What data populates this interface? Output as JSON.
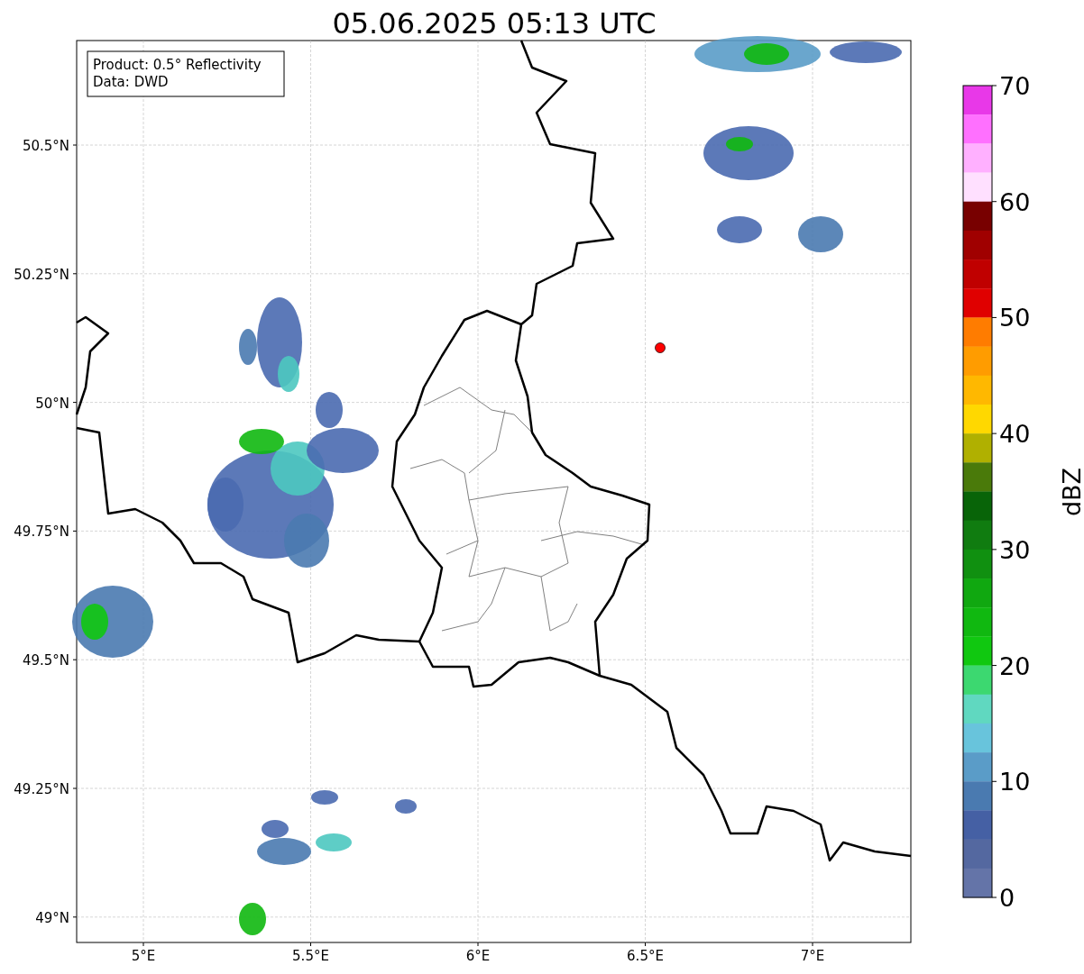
{
  "title": "05.06.2025 05:13 UTC",
  "map": {
    "legend": [
      "Product: 0.5° Reflectivity",
      "Data: DWD"
    ],
    "lat_labels": [
      "50.5°N",
      "50.25°N",
      "50°N",
      "49.75°N",
      "49.5°N",
      "49.25°N",
      "49°N"
    ],
    "lon_labels": [
      "5°E",
      "5.5°E",
      "6°E",
      "6.5°E",
      "7°E"
    ],
    "marker": {
      "color": "#ff0000"
    }
  },
  "colorbar": {
    "label": "dBZ",
    "ticks": [
      "70",
      "60",
      "50",
      "40",
      "30",
      "20",
      "10",
      "0"
    ],
    "bands": [
      {
        "color": "#e838e8"
      },
      {
        "color": "#ff70ff"
      },
      {
        "color": "#ffb0ff"
      },
      {
        "color": "#ffe0ff"
      },
      {
        "color": "#780000"
      },
      {
        "color": "#a00000"
      },
      {
        "color": "#c00000"
      },
      {
        "color": "#e00000"
      },
      {
        "color": "#ff7c00"
      },
      {
        "color": "#ff9c00"
      },
      {
        "color": "#ffb800"
      },
      {
        "color": "#ffd800"
      },
      {
        "color": "#b0b000"
      },
      {
        "color": "#4a7a0a"
      },
      {
        "color": "#086408"
      },
      {
        "color": "#107c10"
      },
      {
        "color": "#109010"
      },
      {
        "color": "#10a810"
      },
      {
        "color": "#10b810"
      },
      {
        "color": "#10c810"
      },
      {
        "color": "#3cd870"
      },
      {
        "color": "#60d8c0"
      },
      {
        "color": "#68c4dc"
      },
      {
        "color": "#5a9cc8"
      },
      {
        "color": "#4a7ab0"
      },
      {
        "color": "#4560a4"
      },
      {
        "color": "#5468a0"
      },
      {
        "color": "#6474a8"
      }
    ]
  }
}
